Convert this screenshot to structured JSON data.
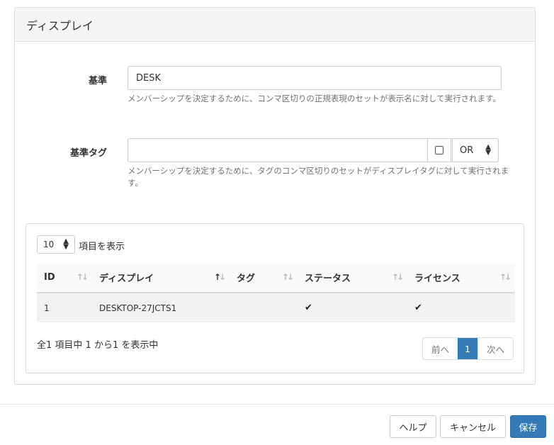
{
  "panel": {
    "title": "ディスプレイ"
  },
  "criteria": {
    "label": "基準",
    "value": "DESK",
    "help": "メンバーシップを決定するために、コンマ区切りの正規表現のセットが表示名に対して実行されます。"
  },
  "criteria_tags": {
    "label": "基準タグ",
    "value": "",
    "help": "メンバーシップを決定するために、タグのコンマ区切りのセットがディスプレイタグに対して実行されます。",
    "operator": "OR",
    "exact_checked": false
  },
  "table": {
    "page_length": "10",
    "page_length_label": "項目を表示",
    "columns": [
      "ID",
      "ディスプレイ",
      "タグ",
      "ステータス",
      "ライセンス"
    ],
    "rows": [
      {
        "id": "1",
        "display": "DESKTOP-27JCTS1",
        "tags": "",
        "status": "✔",
        "license": "✔"
      }
    ],
    "info": "全1 項目中 1 から1 を表示中",
    "pager": {
      "prev": "前へ",
      "current": "1",
      "next": "次へ"
    }
  },
  "footer": {
    "help": "ヘルプ",
    "cancel": "キャンセル",
    "save": "保存"
  }
}
